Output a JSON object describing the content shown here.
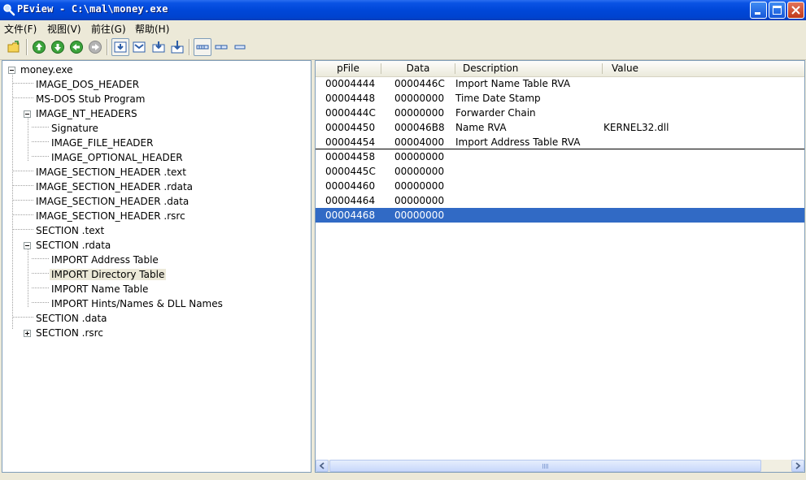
{
  "window": {
    "title": "PEview - C:\\mal\\money.exe",
    "minimize_label": "minimize",
    "maximize_label": "maximize",
    "close_label": "close"
  },
  "menu": {
    "items": [
      "文件(F)",
      "视图(V)",
      "前往(G)",
      "帮助(H)"
    ]
  },
  "toolbar": {
    "buttons": [
      "open-file-icon",
      "go-up-icon",
      "go-down-icon",
      "go-back-icon",
      "go-forward-icon",
      "view-hex-icon",
      "view-section-icon",
      "view-export-icon",
      "view-import-icon",
      "view-wide-icon",
      "view-medium-icon",
      "view-narrow-icon"
    ]
  },
  "tree": {
    "items": [
      "money.exe",
      "IMAGE_DOS_HEADER",
      "MS-DOS Stub Program",
      "IMAGE_NT_HEADERS",
      "Signature",
      "IMAGE_FILE_HEADER",
      "IMAGE_OPTIONAL_HEADER",
      "IMAGE_SECTION_HEADER .text",
      "IMAGE_SECTION_HEADER .rdata",
      "IMAGE_SECTION_HEADER .data",
      "IMAGE_SECTION_HEADER .rsrc",
      "SECTION .text",
      "SECTION .rdata",
      "IMPORT Address Table",
      "IMPORT Directory Table",
      "IMPORT Name Table",
      "IMPORT Hints/Names & DLL Names",
      "SECTION .data",
      "SECTION .rsrc"
    ],
    "selected": "IMPORT Directory Table"
  },
  "list": {
    "columns": [
      "pFile",
      "Data",
      "Description",
      "Value"
    ],
    "rows": [
      {
        "pfile": "00004444",
        "data": "0000446C",
        "description": "Import Name Table RVA",
        "value": ""
      },
      {
        "pfile": "00004448",
        "data": "00000000",
        "description": "Time Date Stamp",
        "value": ""
      },
      {
        "pfile": "0000444C",
        "data": "00000000",
        "description": "Forwarder Chain",
        "value": ""
      },
      {
        "pfile": "00004450",
        "data": "000046B8",
        "description": "Name RVA",
        "value": "KERNEL32.dll"
      },
      {
        "pfile": "00004454",
        "data": "00004000",
        "description": "Import Address Table RVA",
        "value": ""
      },
      {
        "pfile": "00004458",
        "data": "00000000",
        "description": "",
        "value": ""
      },
      {
        "pfile": "0000445C",
        "data": "00000000",
        "description": "",
        "value": ""
      },
      {
        "pfile": "00004460",
        "data": "00000000",
        "description": "",
        "value": ""
      },
      {
        "pfile": "00004464",
        "data": "00000000",
        "description": "",
        "value": ""
      },
      {
        "pfile": "00004468",
        "data": "00000000",
        "description": "",
        "value": ""
      }
    ],
    "selected_index": 9
  },
  "colors": {
    "selection": "#316ac5",
    "titlebar": "#0047d8",
    "chrome": "#ece9d8"
  }
}
